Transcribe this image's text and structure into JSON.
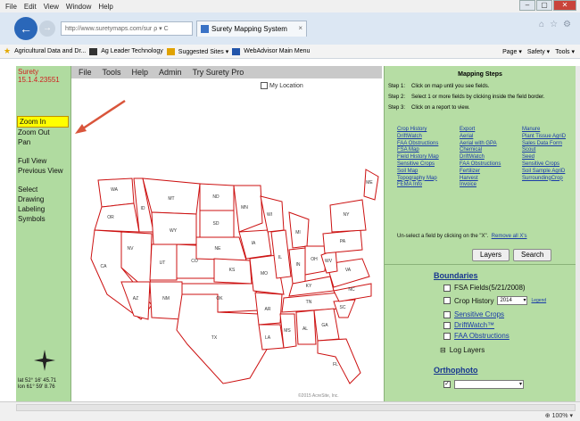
{
  "browser": {
    "menu": [
      "File",
      "Edit",
      "View",
      "Window",
      "Help"
    ],
    "url": "http://www.suretymaps.com/sur",
    "url_suffix": "ρ ▾ C",
    "tab_title": "Surety Mapping System",
    "tab_close": "×",
    "win_minimize": "–",
    "win_restore": "▢",
    "win_close": "✕",
    "favorites": [
      "Agricultural Data and Dr...",
      "Ag Leader Technology",
      "Suggested Sites ▾",
      "WebAdvisor Main Menu"
    ],
    "commands": [
      "Page ▾",
      "Safety ▾",
      "Tools ▾"
    ],
    "zoom": "100%"
  },
  "app": {
    "version_name": "Surety",
    "version_number": "15.1.4.23551",
    "menu": [
      "File",
      "Tools",
      "Help",
      "Admin",
      "Try Surety Pro"
    ],
    "my_location": "My Location",
    "nav_group1": [
      "Zoom In",
      "Zoom Out",
      "Pan"
    ],
    "nav_group2": [
      "Full View",
      "Previous View"
    ],
    "nav_group3": [
      "Select",
      "Drawing",
      "Labeling",
      "Symbols"
    ],
    "coords_lat": "lat 52° 16' 45.71",
    "coords_lon": "lon 61° 59' 8.76",
    "copyright": "©2015 AcreSite, Inc."
  },
  "map": {
    "state_labels": [
      "WA",
      "OR",
      "CA",
      "NV",
      "ID",
      "MT",
      "WY",
      "UT",
      "AZ",
      "CO",
      "NM",
      "ND",
      "SD",
      "NE",
      "KS",
      "OK",
      "TX",
      "MN",
      "IA",
      "MO",
      "AR",
      "LA",
      "WI",
      "IL",
      "MS",
      "MI",
      "IN",
      "KY",
      "TN",
      "AL",
      "OH",
      "GA",
      "FL",
      "SC",
      "NC",
      "VA",
      "WV",
      "PA",
      "NY",
      "ME"
    ],
    "state_color": "#cc1111"
  },
  "mapping_steps": {
    "title": "Mapping Steps",
    "steps": [
      {
        "label": "Step 1:",
        "text": "Click on map until you see fields."
      },
      {
        "label": "Step 2:",
        "text": "Select 1 or more fields by clicking inside the field border."
      },
      {
        "label": "Step 3:",
        "text": "Click on a report to view."
      }
    ],
    "reports": [
      "Crop History",
      "Export",
      "Manure",
      "DriftWatch",
      "Aerial",
      "Plant Tissue AgriD",
      "FAA Obstructions",
      "Aerial with GPA",
      "Sales Data Form",
      "FSA Map",
      "Chemical",
      "Scout",
      "Field History Map",
      "DriftWatch",
      "Seed",
      "Sensitive Crops",
      "FAA Obstructions",
      "Sensitive Crops",
      "Soil Map",
      "Fertilizer",
      "Soil Sample AgriD",
      "Topography Map",
      "Harvest",
      "SurroundingCrop",
      "FEMA Info",
      "Invoice",
      ""
    ],
    "unselect_text": "Un-select a field by clicking on the \"X\".",
    "remove_all": "Remove all X's",
    "layers_button": "Layers",
    "search_button": "Search"
  },
  "layers": {
    "boundaries_title": "Boundaries",
    "fsa_fields": "FSA Fields(5/21/2008)",
    "crop_history": "Crop History",
    "crop_year": "2014",
    "legend_link": "Legend",
    "sensitive_crops": "Sensitive Crops",
    "driftwatch": "DriftWatch™",
    "faa_obstructions": "FAA Obstructions",
    "log_layers": "Log Layers",
    "log_prefix": "⊟",
    "orthophoto_title": "Orthophoto",
    "checkmark": "✓"
  },
  "colors": {
    "panel_green": "#b6dda4",
    "highlight_yellow": "#ffff00",
    "annotation_arrow": "#d9553b",
    "link_blue": "#1a3ba8"
  }
}
